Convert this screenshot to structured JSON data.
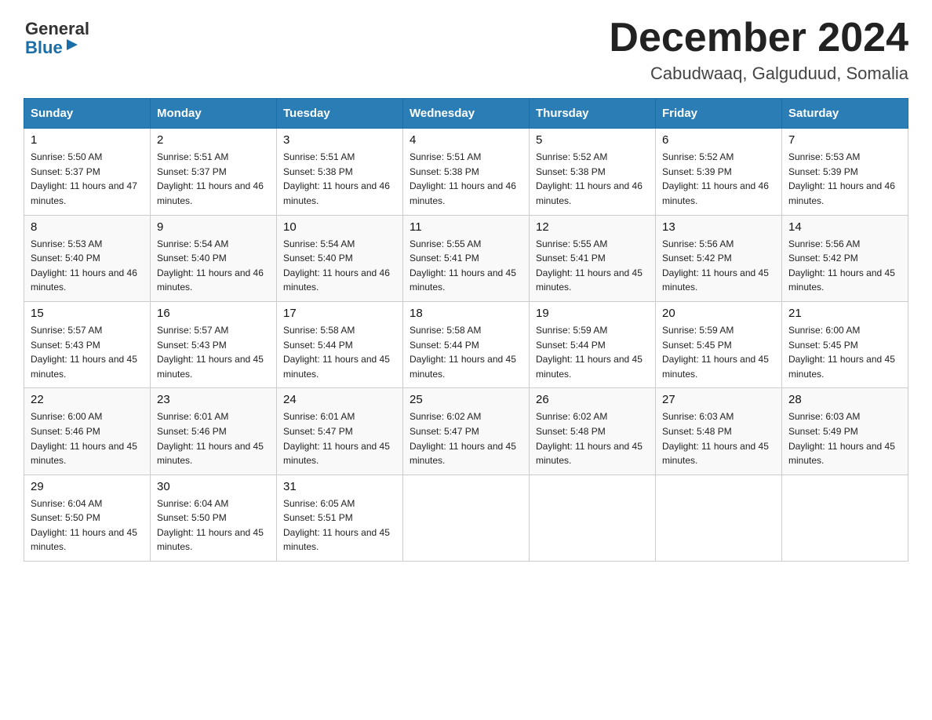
{
  "header": {
    "logo_general": "General",
    "logo_blue": "Blue",
    "month_title": "December 2024",
    "location": "Cabudwaaq, Galguduud, Somalia"
  },
  "weekdays": [
    "Sunday",
    "Monday",
    "Tuesday",
    "Wednesday",
    "Thursday",
    "Friday",
    "Saturday"
  ],
  "weeks": [
    [
      {
        "day": "1",
        "sunrise": "5:50 AM",
        "sunset": "5:37 PM",
        "daylight": "11 hours and 47 minutes."
      },
      {
        "day": "2",
        "sunrise": "5:51 AM",
        "sunset": "5:37 PM",
        "daylight": "11 hours and 46 minutes."
      },
      {
        "day": "3",
        "sunrise": "5:51 AM",
        "sunset": "5:38 PM",
        "daylight": "11 hours and 46 minutes."
      },
      {
        "day": "4",
        "sunrise": "5:51 AM",
        "sunset": "5:38 PM",
        "daylight": "11 hours and 46 minutes."
      },
      {
        "day": "5",
        "sunrise": "5:52 AM",
        "sunset": "5:38 PM",
        "daylight": "11 hours and 46 minutes."
      },
      {
        "day": "6",
        "sunrise": "5:52 AM",
        "sunset": "5:39 PM",
        "daylight": "11 hours and 46 minutes."
      },
      {
        "day": "7",
        "sunrise": "5:53 AM",
        "sunset": "5:39 PM",
        "daylight": "11 hours and 46 minutes."
      }
    ],
    [
      {
        "day": "8",
        "sunrise": "5:53 AM",
        "sunset": "5:40 PM",
        "daylight": "11 hours and 46 minutes."
      },
      {
        "day": "9",
        "sunrise": "5:54 AM",
        "sunset": "5:40 PM",
        "daylight": "11 hours and 46 minutes."
      },
      {
        "day": "10",
        "sunrise": "5:54 AM",
        "sunset": "5:40 PM",
        "daylight": "11 hours and 46 minutes."
      },
      {
        "day": "11",
        "sunrise": "5:55 AM",
        "sunset": "5:41 PM",
        "daylight": "11 hours and 45 minutes."
      },
      {
        "day": "12",
        "sunrise": "5:55 AM",
        "sunset": "5:41 PM",
        "daylight": "11 hours and 45 minutes."
      },
      {
        "day": "13",
        "sunrise": "5:56 AM",
        "sunset": "5:42 PM",
        "daylight": "11 hours and 45 minutes."
      },
      {
        "day": "14",
        "sunrise": "5:56 AM",
        "sunset": "5:42 PM",
        "daylight": "11 hours and 45 minutes."
      }
    ],
    [
      {
        "day": "15",
        "sunrise": "5:57 AM",
        "sunset": "5:43 PM",
        "daylight": "11 hours and 45 minutes."
      },
      {
        "day": "16",
        "sunrise": "5:57 AM",
        "sunset": "5:43 PM",
        "daylight": "11 hours and 45 minutes."
      },
      {
        "day": "17",
        "sunrise": "5:58 AM",
        "sunset": "5:44 PM",
        "daylight": "11 hours and 45 minutes."
      },
      {
        "day": "18",
        "sunrise": "5:58 AM",
        "sunset": "5:44 PM",
        "daylight": "11 hours and 45 minutes."
      },
      {
        "day": "19",
        "sunrise": "5:59 AM",
        "sunset": "5:44 PM",
        "daylight": "11 hours and 45 minutes."
      },
      {
        "day": "20",
        "sunrise": "5:59 AM",
        "sunset": "5:45 PM",
        "daylight": "11 hours and 45 minutes."
      },
      {
        "day": "21",
        "sunrise": "6:00 AM",
        "sunset": "5:45 PM",
        "daylight": "11 hours and 45 minutes."
      }
    ],
    [
      {
        "day": "22",
        "sunrise": "6:00 AM",
        "sunset": "5:46 PM",
        "daylight": "11 hours and 45 minutes."
      },
      {
        "day": "23",
        "sunrise": "6:01 AM",
        "sunset": "5:46 PM",
        "daylight": "11 hours and 45 minutes."
      },
      {
        "day": "24",
        "sunrise": "6:01 AM",
        "sunset": "5:47 PM",
        "daylight": "11 hours and 45 minutes."
      },
      {
        "day": "25",
        "sunrise": "6:02 AM",
        "sunset": "5:47 PM",
        "daylight": "11 hours and 45 minutes."
      },
      {
        "day": "26",
        "sunrise": "6:02 AM",
        "sunset": "5:48 PM",
        "daylight": "11 hours and 45 minutes."
      },
      {
        "day": "27",
        "sunrise": "6:03 AM",
        "sunset": "5:48 PM",
        "daylight": "11 hours and 45 minutes."
      },
      {
        "day": "28",
        "sunrise": "6:03 AM",
        "sunset": "5:49 PM",
        "daylight": "11 hours and 45 minutes."
      }
    ],
    [
      {
        "day": "29",
        "sunrise": "6:04 AM",
        "sunset": "5:50 PM",
        "daylight": "11 hours and 45 minutes."
      },
      {
        "day": "30",
        "sunrise": "6:04 AM",
        "sunset": "5:50 PM",
        "daylight": "11 hours and 45 minutes."
      },
      {
        "day": "31",
        "sunrise": "6:05 AM",
        "sunset": "5:51 PM",
        "daylight": "11 hours and 45 minutes."
      },
      null,
      null,
      null,
      null
    ]
  ]
}
